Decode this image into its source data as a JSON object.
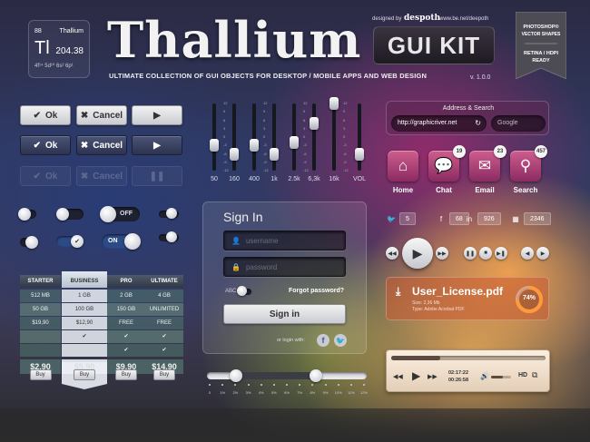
{
  "element": {
    "number": "88",
    "name": "Thallium",
    "symbol": "Tl",
    "mass": "204.38",
    "config": "4f¹⁴ 5d¹⁰ 6s² 6p¹"
  },
  "header": {
    "title": "Thallium",
    "kit_label": "GUI KIT",
    "designed_by": "designed by",
    "designer_logo": "despoth",
    "url": "www.be.net/deepoth",
    "subtitle": "ULTIMATE COLLECTION OF GUI OBJECTS FOR DESKTOP / MOBILE APPS AND WEB DESIGN",
    "version": "v. 1.0.0"
  },
  "ribbon": {
    "line1": "PHOTOSHOP®",
    "line2": "VECTOR SHAPES",
    "line3": "RETINA / HDPI",
    "line4": "READY"
  },
  "buttons": {
    "ok": "Ok",
    "cancel": "Cancel",
    "play": "▶",
    "pause": "❚❚"
  },
  "equalizer": {
    "ticks": [
      "12",
      "9",
      "6",
      "3",
      "0",
      "-3",
      "-6",
      "-9",
      "-12"
    ],
    "bands": [
      {
        "label": "50",
        "level": -3
      },
      {
        "label": "160",
        "level": -6
      },
      {
        "label": "400",
        "level": -3
      },
      {
        "label": "1k",
        "level": -6
      },
      {
        "label": "2.5k",
        "level": -2
      },
      {
        "label": "6,3k",
        "level": 5
      },
      {
        "label": "16k",
        "level": 12
      },
      {
        "label": "VOL",
        "level": -6
      }
    ]
  },
  "toggles": {
    "off_label": "OFF",
    "on_label": "ON"
  },
  "pricing": {
    "plans": [
      "STARTER",
      "BUSINESS",
      "PRO",
      "ULTIMATE"
    ],
    "rows": [
      [
        "512 MB",
        "1 GB",
        "2 GB",
        "4 GB"
      ],
      [
        "50 GB",
        "100 GB",
        "150 GB",
        "UNLIMITED"
      ],
      [
        "$19,90",
        "$12,90",
        "FREE",
        "FREE"
      ],
      [
        "",
        "✔",
        "✔",
        "✔"
      ],
      [
        "",
        "",
        "✔",
        "✔"
      ]
    ],
    "prices": [
      "$2.90",
      "$5.90",
      "$9.90",
      "$14.90"
    ],
    "buy_label": "Buy"
  },
  "signin": {
    "title": "Sign In",
    "username_placeholder": "username",
    "password_placeholder": "password",
    "remember_label": "ABC",
    "forgot_label": "Forgot password?",
    "submit_label": "Sign in",
    "social_label": "or login with:"
  },
  "slider": {
    "ticks": [
      "0",
      "1%",
      "2%",
      "3%",
      "4%",
      "5%",
      "6%",
      "7%",
      "8%",
      "9%",
      "10%",
      "11%",
      "12%"
    ],
    "low": 0.18,
    "high": 0.68
  },
  "address": {
    "title": "Address & Search",
    "url": "http://graphicriver.net",
    "search_placeholder": "Google"
  },
  "apps": [
    {
      "label": "Home",
      "icon": "home-icon",
      "badge": ""
    },
    {
      "label": "Chat",
      "icon": "chat-icon",
      "badge": "19"
    },
    {
      "label": "Email",
      "icon": "email-icon",
      "badge": "23"
    },
    {
      "label": "Search",
      "icon": "search-icon",
      "badge": "457"
    }
  ],
  "social": [
    {
      "icon": "twitter-icon",
      "count": "5"
    },
    {
      "icon": "facebook-icon",
      "count": "68"
    },
    {
      "icon": "linkedin-icon",
      "count": "926"
    },
    {
      "icon": "delicious-icon",
      "count": "2346"
    }
  ],
  "download": {
    "filename": "User_License.pdf",
    "size": "Size: 2,36 Mb",
    "type": "Type: Adobe Acrobat PDF",
    "progress_label": "74%",
    "progress": 0.74
  },
  "player": {
    "elapsed": "02:17:22",
    "remaining": "00:26:58",
    "hd_label": "HD",
    "progress": 0.32,
    "volume": 0.6
  }
}
